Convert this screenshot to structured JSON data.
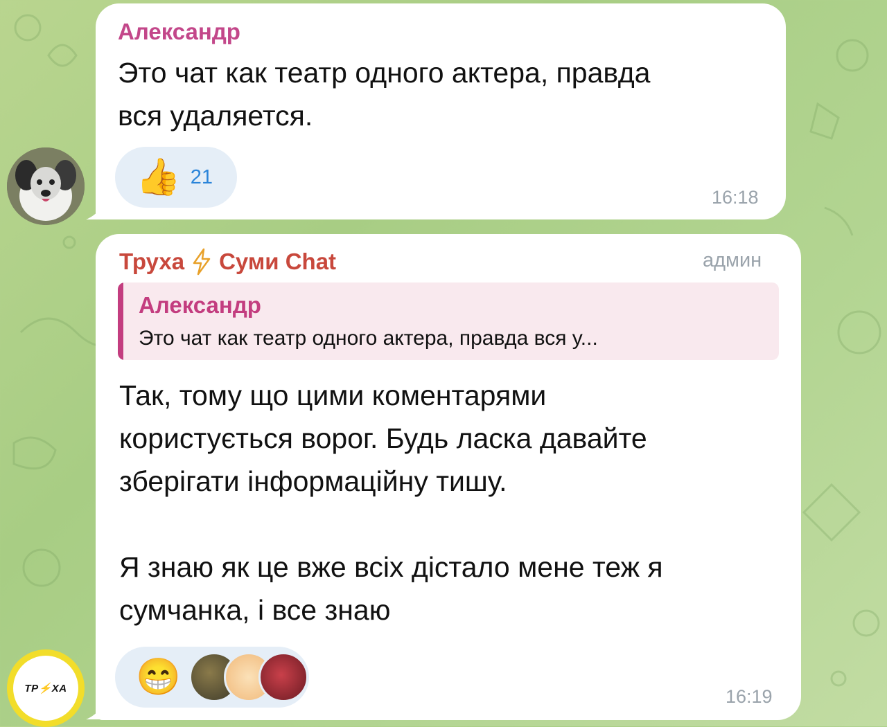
{
  "colors": {
    "background": "#b3d592",
    "bubble": "#ffffff",
    "sender_pink": "#c3478a",
    "sender_red": "#c8483c",
    "quote_accent": "#c33d7f",
    "quote_bg": "#f9e9ee",
    "reaction_bg": "#e5eef7",
    "reaction_count": "#2a84d9",
    "timestamp": "#9aa3ab"
  },
  "messages": [
    {
      "sender": "Александр",
      "text_lines": [
        "Это чат как театр одного актера, правда",
        "вся удаляется."
      ],
      "reaction": {
        "icon": "thumbs-up-icon",
        "emoji": "👍",
        "count": "21"
      },
      "time": "16:18",
      "avatar": "dog-avatar"
    },
    {
      "sender": "Труха",
      "sender_icon": "lightning-icon",
      "sender_suffix": "Суми Chat",
      "role": "админ",
      "reply": {
        "name": "Александр",
        "text": "Это чат как театр одного актера, правда вся у..."
      },
      "paragraphs": [
        [
          "Так, тому що цими коментарями",
          "користується ворог. Будь ласка давайте",
          "зберігати інформаційну тишу."
        ],
        [
          "Я знаю як це вже всіх дістало мене теж я",
          "сумчанка, і все знаю"
        ]
      ],
      "reaction": {
        "icon": "grinning-face-icon",
        "emoji": "😁"
      },
      "time": "16:19",
      "avatar_logo": "ТР⚡ХА"
    }
  ]
}
